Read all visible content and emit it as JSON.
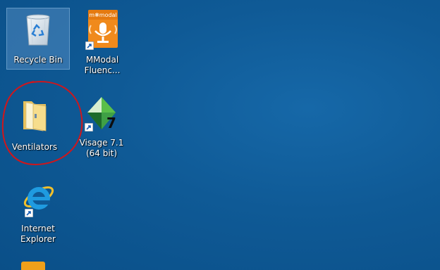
{
  "desktop": {
    "background_color": "#0f5a96",
    "annotation_color": "#d0161b",
    "icons": [
      {
        "name": "recycle-bin",
        "label": "Recycle Bin",
        "selected": true
      },
      {
        "name": "mmodal-fluency",
        "label": "MModal Fluenc...",
        "logo_text": "m❋modal",
        "shortcut": true
      },
      {
        "name": "ventilators-folder",
        "label": "Ventilators",
        "shortcut": false
      },
      {
        "name": "visage",
        "label": "Visage 7.1 (64 bit)",
        "badge": "7",
        "shortcut": true
      },
      {
        "name": "internet-explorer",
        "label": "Internet Explorer",
        "shortcut": true
      }
    ]
  }
}
